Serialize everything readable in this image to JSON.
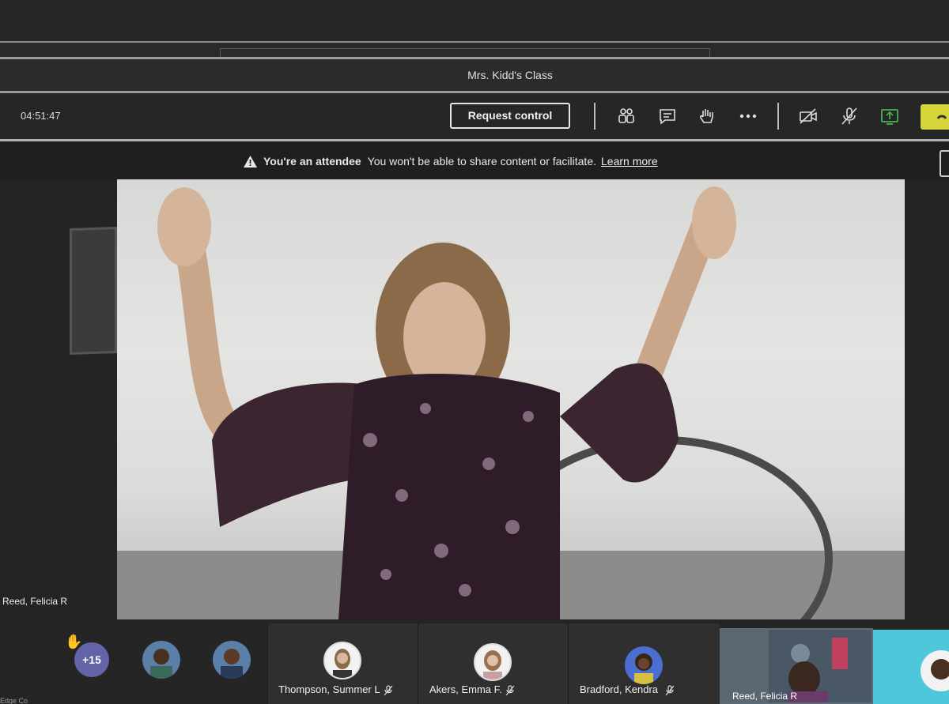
{
  "window": {
    "title": "Mrs. Kidd's Class"
  },
  "controls": {
    "timer": "04:51:47",
    "request_control_label": "Request control",
    "icons": [
      "participants-icon",
      "chat-icon",
      "raise-hand-icon",
      "more-options-icon",
      "camera-off-icon",
      "mic-off-icon",
      "share-icon",
      "hang-up-icon"
    ],
    "share_color": "#4caf50",
    "hangup_color": "#d6d63a"
  },
  "banner": {
    "title": "You're an attendee",
    "message": "You won't be able to share content or facilitate.",
    "link": "Learn more"
  },
  "stage": {
    "presenter_name": "Reed, Felicia R"
  },
  "strip": {
    "overflow_count": "+15",
    "participants": [
      {
        "name": "Thompson, Summer L"
      },
      {
        "name": "Akers, Emma F."
      },
      {
        "name": "Bradford, Kendra"
      }
    ],
    "self_name": "Reed, Felicia R"
  },
  "taskbar": {
    "text": "Edge Co"
  },
  "colors": {
    "accent": "#6264a7",
    "background": "#1c1c1c"
  }
}
